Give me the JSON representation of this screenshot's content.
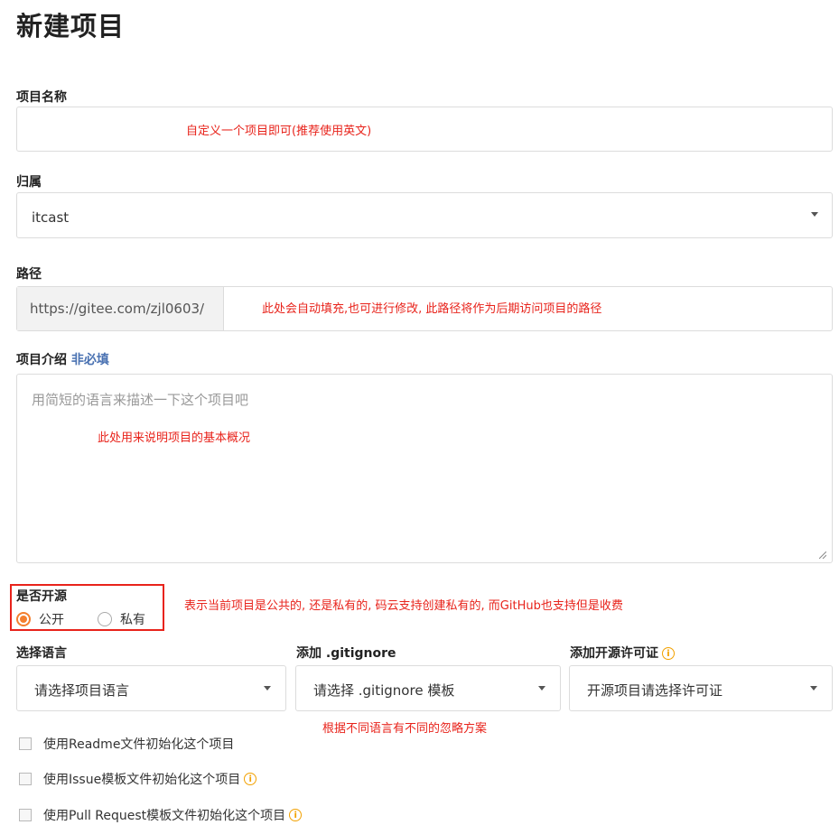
{
  "page": {
    "title": "新建项目"
  },
  "name": {
    "label": "项目名称",
    "value": "",
    "annotation": "自定义一个项目即可(推荐使用英文)"
  },
  "owner": {
    "label": "归属",
    "value": "itcast"
  },
  "path": {
    "label": "路径",
    "prefix": "https://gitee.com/zjl0603/",
    "value": "",
    "annotation": "此处会自动填充,也可进行修改, 此路径将作为后期访问项目的路径"
  },
  "description": {
    "label": "项目介绍",
    "optional_tag": "非必填",
    "placeholder": "用简短的语言来描述一下这个项目吧",
    "annotation": "此处用来说明项目的基本概况"
  },
  "visibility": {
    "label": "是否开源",
    "options": [
      "公开",
      "私有"
    ],
    "selected": "公开",
    "annotation": "表示当前项目是公共的, 还是私有的, 码云支持创建私有的, 而GitHub也支持但是收费",
    "highlight_color": "#e8231b"
  },
  "language": {
    "label": "选择语言",
    "placeholder": "请选择项目语言"
  },
  "gitignore": {
    "label": "添加 .gitignore",
    "placeholder": "请选择 .gitignore 模板",
    "annotation": "根据不同语言有不同的忽略方案"
  },
  "license": {
    "label": "添加开源许可证",
    "placeholder": "开源项目请选择许可证",
    "info_icon": "info-icon"
  },
  "checkboxes": [
    {
      "label": "使用Readme文件初始化这个项目",
      "checked": false,
      "info": false
    },
    {
      "label": "使用Issue模板文件初始化这个项目",
      "checked": false,
      "info": true
    },
    {
      "label": "使用Pull Request模板文件初始化这个项目",
      "checked": false,
      "info": true
    }
  ],
  "colors": {
    "accent": "#f47f2e",
    "annotation": "#e8231b",
    "info": "#f2a100",
    "optional": "#4a72b2"
  }
}
